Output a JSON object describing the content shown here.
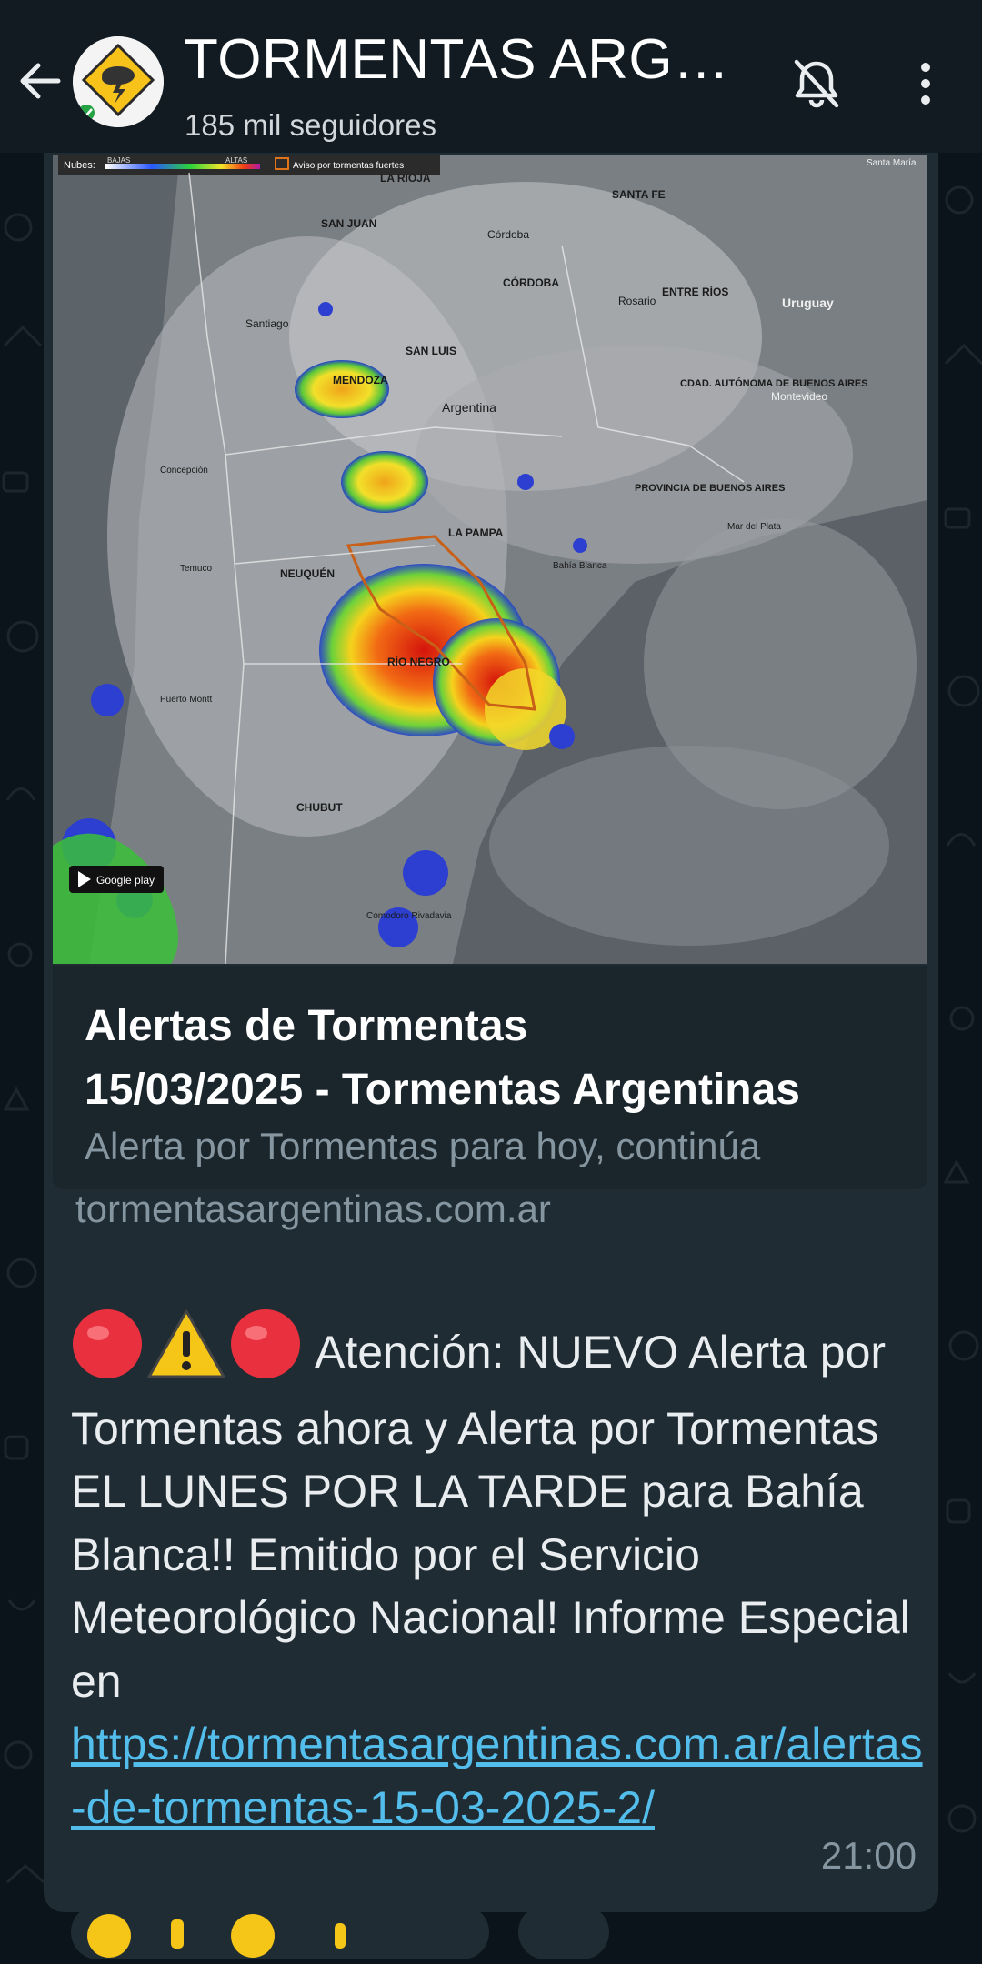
{
  "header": {
    "channel_name": "TORMENTAS ARGENTINAS",
    "followers": "185 mil seguidores"
  },
  "icons": {
    "back": "arrow-left-icon",
    "avatar": "storm-warning-logo",
    "mute": "bell-off-icon",
    "menu": "more-vertical-icon"
  },
  "message": {
    "link_preview": {
      "title_line1": "Alertas de Tormentas",
      "title_line2": "15/03/2025 - Tormentas Argentinas",
      "description": "Alerta por Tormentas para hoy, continúa",
      "domain": "tormentasargentinas.com.ar"
    },
    "map_labels": {
      "legend_clouds": "Nubes:",
      "legend_low": "BAJAS",
      "legend_high": "ALTAS",
      "legend_warning": "Aviso por tormentas fuertes",
      "google_play": "Google play",
      "places": [
        "LA RIOJA",
        "SANTA FE",
        "SAN JUAN",
        "Córdoba",
        "CÓRDOBA",
        "ENTRE RÍOS",
        "Uruguay",
        "Rosario",
        "Santiago",
        "SAN LUIS",
        "MENDOZA",
        "Argentina",
        "CDAD. AUTÓNOMA DE BUENOS AIRES",
        "Montevideo",
        "PROVINCIA DE BUENOS AIRES",
        "LA PAMPA",
        "NEUQUÉN",
        "Bahía Blanca",
        "RÍO NEGRO",
        "CHUBUT",
        "Mar del Plata",
        "Concepción",
        "Temuco",
        "Puerto Montt",
        "Comodoro Rivadavia",
        "Santa María"
      ]
    },
    "text": "Atención: NUEVO Alerta por Tormentas ahora y Alerta por Tormentas EL LUNES POR LA TARDE para Bahía Blanca!! Emitido por el Servicio Meteorológico Nacional! Informe Especial en",
    "link_url": "https://tormentasargentinas.com.ar/alertas-de-tormentas-15-03-2025-2/",
    "time": "21:00"
  },
  "colors": {
    "background": "#0b141a",
    "header": "#111b21",
    "bubble": "#1f2c34",
    "link": "#53bdeb",
    "muted_text": "#8696a0"
  }
}
